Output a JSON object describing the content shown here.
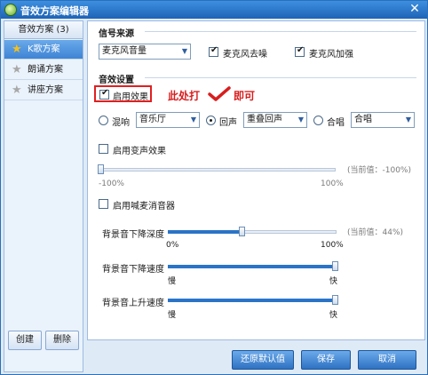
{
  "window": {
    "title": "音效方案编辑器",
    "close": "✕"
  },
  "sidebar": {
    "header": "音效方案 (3)",
    "items": [
      {
        "label": "K歌方案",
        "selected": true,
        "icon": "star-gold-icon"
      },
      {
        "label": "朗诵方案",
        "selected": false,
        "icon": "star-gray-icon"
      },
      {
        "label": "讲座方案",
        "selected": false,
        "icon": "star-gray-icon"
      }
    ],
    "create_label": "创建",
    "delete_label": "删除"
  },
  "signal": {
    "title": "信号来源",
    "source_value": "麦克风音量",
    "denoise_label": "麦克风去噪",
    "denoise_checked": true,
    "boost_label": "麦克风加强",
    "boost_checked": true
  },
  "effects": {
    "title": "音效设置",
    "enable_label": "启用效果",
    "enable_checked": true,
    "annotation": "此处打",
    "annotation_tail": "即可",
    "reverb_label": "混响",
    "reverb_value": "音乐厅",
    "echo_label": "回声",
    "echo_value": "重叠回声",
    "chorus_label": "合唱",
    "chorus_value": "合唱",
    "selected_mode": "echo",
    "voice_change_label": "启用变声效果",
    "voice_change_checked": false,
    "voice_change_value_label": "(当前值：-100%)",
    "voice_change_min": "-100%",
    "voice_change_max": "100%",
    "voice_change_level": 0.0,
    "mic_blend_label": "启用喊麦消音器",
    "mic_blend_checked": false,
    "bg_drop_depth_label": "背景音下降深度",
    "bg_drop_depth_value_label": "(当前值：44%)",
    "bg_drop_depth_min": "0%",
    "bg_drop_depth_max": "100%",
    "bg_drop_depth_level": 0.44,
    "bg_drop_speed_label": "背景音下降速度",
    "bg_drop_speed_min": "慢",
    "bg_drop_speed_max": "快",
    "bg_drop_speed_level": 1.0,
    "bg_rise_speed_label": "背景音上升速度",
    "bg_rise_speed_min": "慢",
    "bg_rise_speed_max": "快",
    "bg_rise_speed_level": 1.0
  },
  "footer": {
    "restore_label": "还原默认值",
    "save_label": "保存",
    "cancel_label": "取消"
  },
  "colors": {
    "title_bar": "#1e63b5",
    "accent": "#2a74c8",
    "annotation": "#d81e1e"
  }
}
